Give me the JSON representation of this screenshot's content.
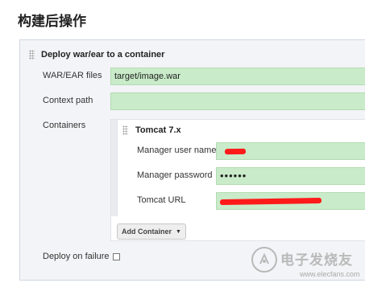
{
  "page_title": "构建后操作",
  "section": {
    "title": "Deploy war/ear to a container",
    "war_label": "WAR/EAR files",
    "war_value": "target/image.war",
    "context_label": "Context path",
    "context_value": "",
    "containers_label": "Containers",
    "container": {
      "title": "Tomcat 7.x",
      "user_label": "Manager user name",
      "password_label": "Manager password",
      "password_value": "••••••",
      "url_label": "Tomcat URL"
    },
    "add_container_label": "Add Container",
    "deploy_on_failure_label": "Deploy on failure"
  },
  "colors": {
    "field_bg": "#c9ebc9",
    "redaction": "#ff1a1a"
  },
  "watermark": {
    "text": "电子发烧友",
    "url": "www.elecfans.com"
  }
}
